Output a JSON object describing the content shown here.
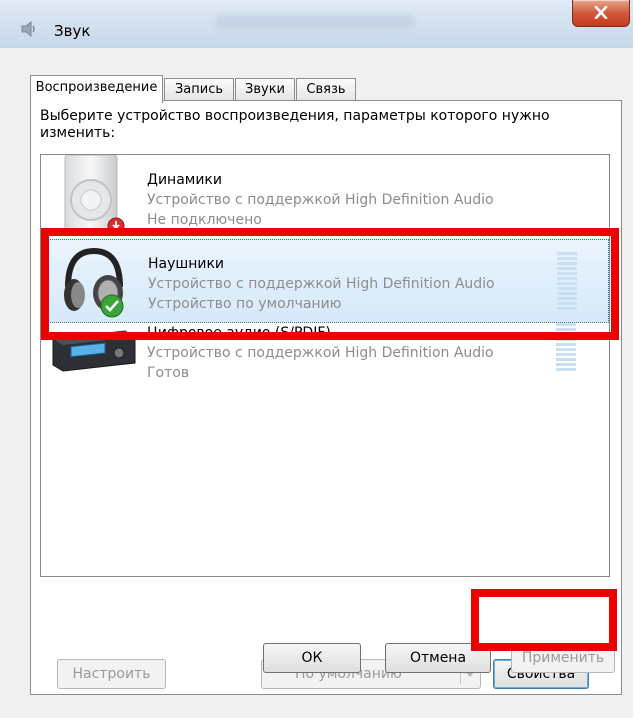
{
  "window": {
    "title": "Звук"
  },
  "tabs": [
    {
      "label": "Воспроизведение",
      "active": true
    },
    {
      "label": "Запись",
      "active": false
    },
    {
      "label": "Звуки",
      "active": false
    },
    {
      "label": "Связь",
      "active": false
    }
  ],
  "instruction": "Выберите устройство воспроизведения, параметры которого нужно изменить:",
  "devices": [
    {
      "name": "Динамики",
      "description": "Устройство с поддержкой High Definition Audio",
      "status": "Не подключено",
      "icon": "speaker-icon",
      "badge": "disconnected-badge-icon",
      "selected": false
    },
    {
      "name": "Наушники",
      "description": "Устройство с поддержкой High Definition Audio",
      "status": "Устройство по умолчанию",
      "icon": "headphones-icon",
      "badge": "default-check-icon",
      "selected": true
    },
    {
      "name": "Цифровое аудио (S/PDIF)",
      "description": "Устройство с поддержкой High Definition Audio",
      "status": "Готов",
      "icon": "digital-receiver-icon",
      "selected": false
    }
  ],
  "buttons": {
    "configure": "Настроить",
    "set_default": "По умолчанию",
    "properties": "Свойства",
    "ok": "ОК",
    "cancel": "Отмена",
    "apply": "Применить"
  },
  "colors": {
    "highlight": "#ee0000",
    "selection": "#d6e9fa",
    "close": "#c43a1d"
  }
}
